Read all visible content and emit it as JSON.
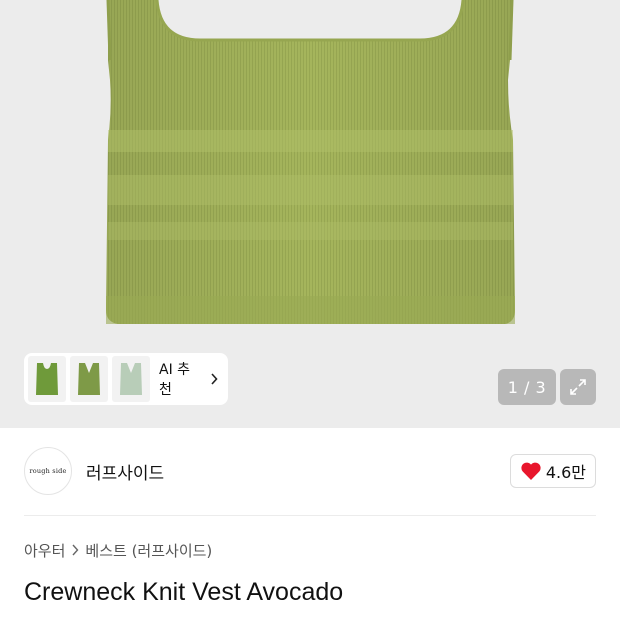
{
  "hero": {
    "image_alt": "green knit vest",
    "ai_recommend_label": "AI 추천",
    "page_counter": "1 / 3",
    "colors": {
      "vest": "#a3b35b",
      "background": "#ececec"
    }
  },
  "brand": {
    "logo_text": "rough side",
    "name": "러프사이드",
    "like_count": "4.6만"
  },
  "breadcrumb": {
    "items": [
      "아우터",
      "베스트 (러프사이드)"
    ]
  },
  "product": {
    "title": "Crewneck Knit Vest Avocado"
  }
}
